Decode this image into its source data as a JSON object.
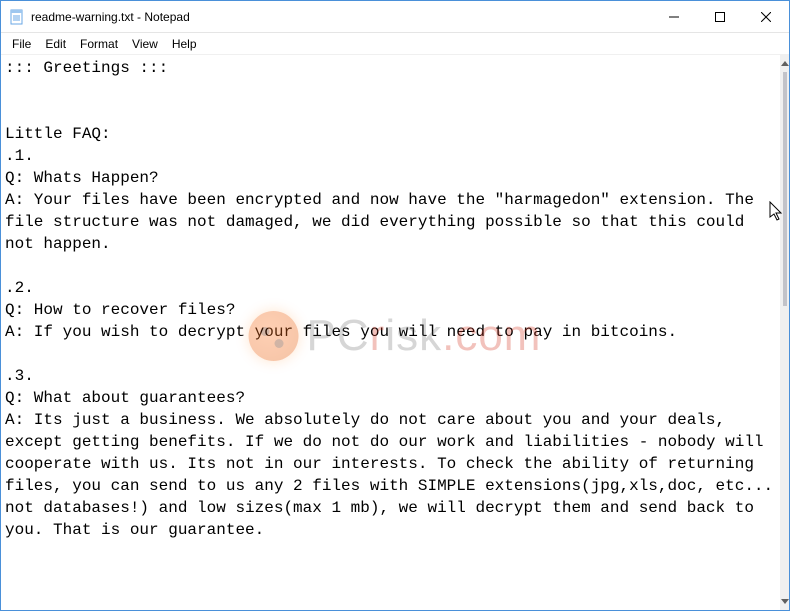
{
  "titlebar": {
    "title": "readme-warning.txt - Notepad"
  },
  "menubar": {
    "file": "File",
    "edit": "Edit",
    "format": "Format",
    "view": "View",
    "help": "Help"
  },
  "document": {
    "text": "::: Greetings :::\n\n\nLittle FAQ:\n.1.\nQ: Whats Happen?\nA: Your files have been encrypted and now have the \"harmagedon\" extension. The file structure was not damaged, we did everything possible so that this could not happen.\n\n.2.\nQ: How to recover files?\nA: If you wish to decrypt your files you will need to pay in bitcoins.\n\n.3.\nQ: What about guarantees?\nA: Its just a business. We absolutely do not care about you and your deals, except getting benefits. If we do not do our work and liabilities - nobody will cooperate with us. Its not in our interests. To check the ability of returning files, you can send to us any 2 files with SIMPLE extensions(jpg,xls,doc, etc... not databases!) and low sizes(max 1 mb), we will decrypt them and send back to you. That is our guarantee."
  },
  "watermark": {
    "prefix": "PC",
    "r": "r",
    "middle": "isk",
    "suffix": ".com"
  }
}
